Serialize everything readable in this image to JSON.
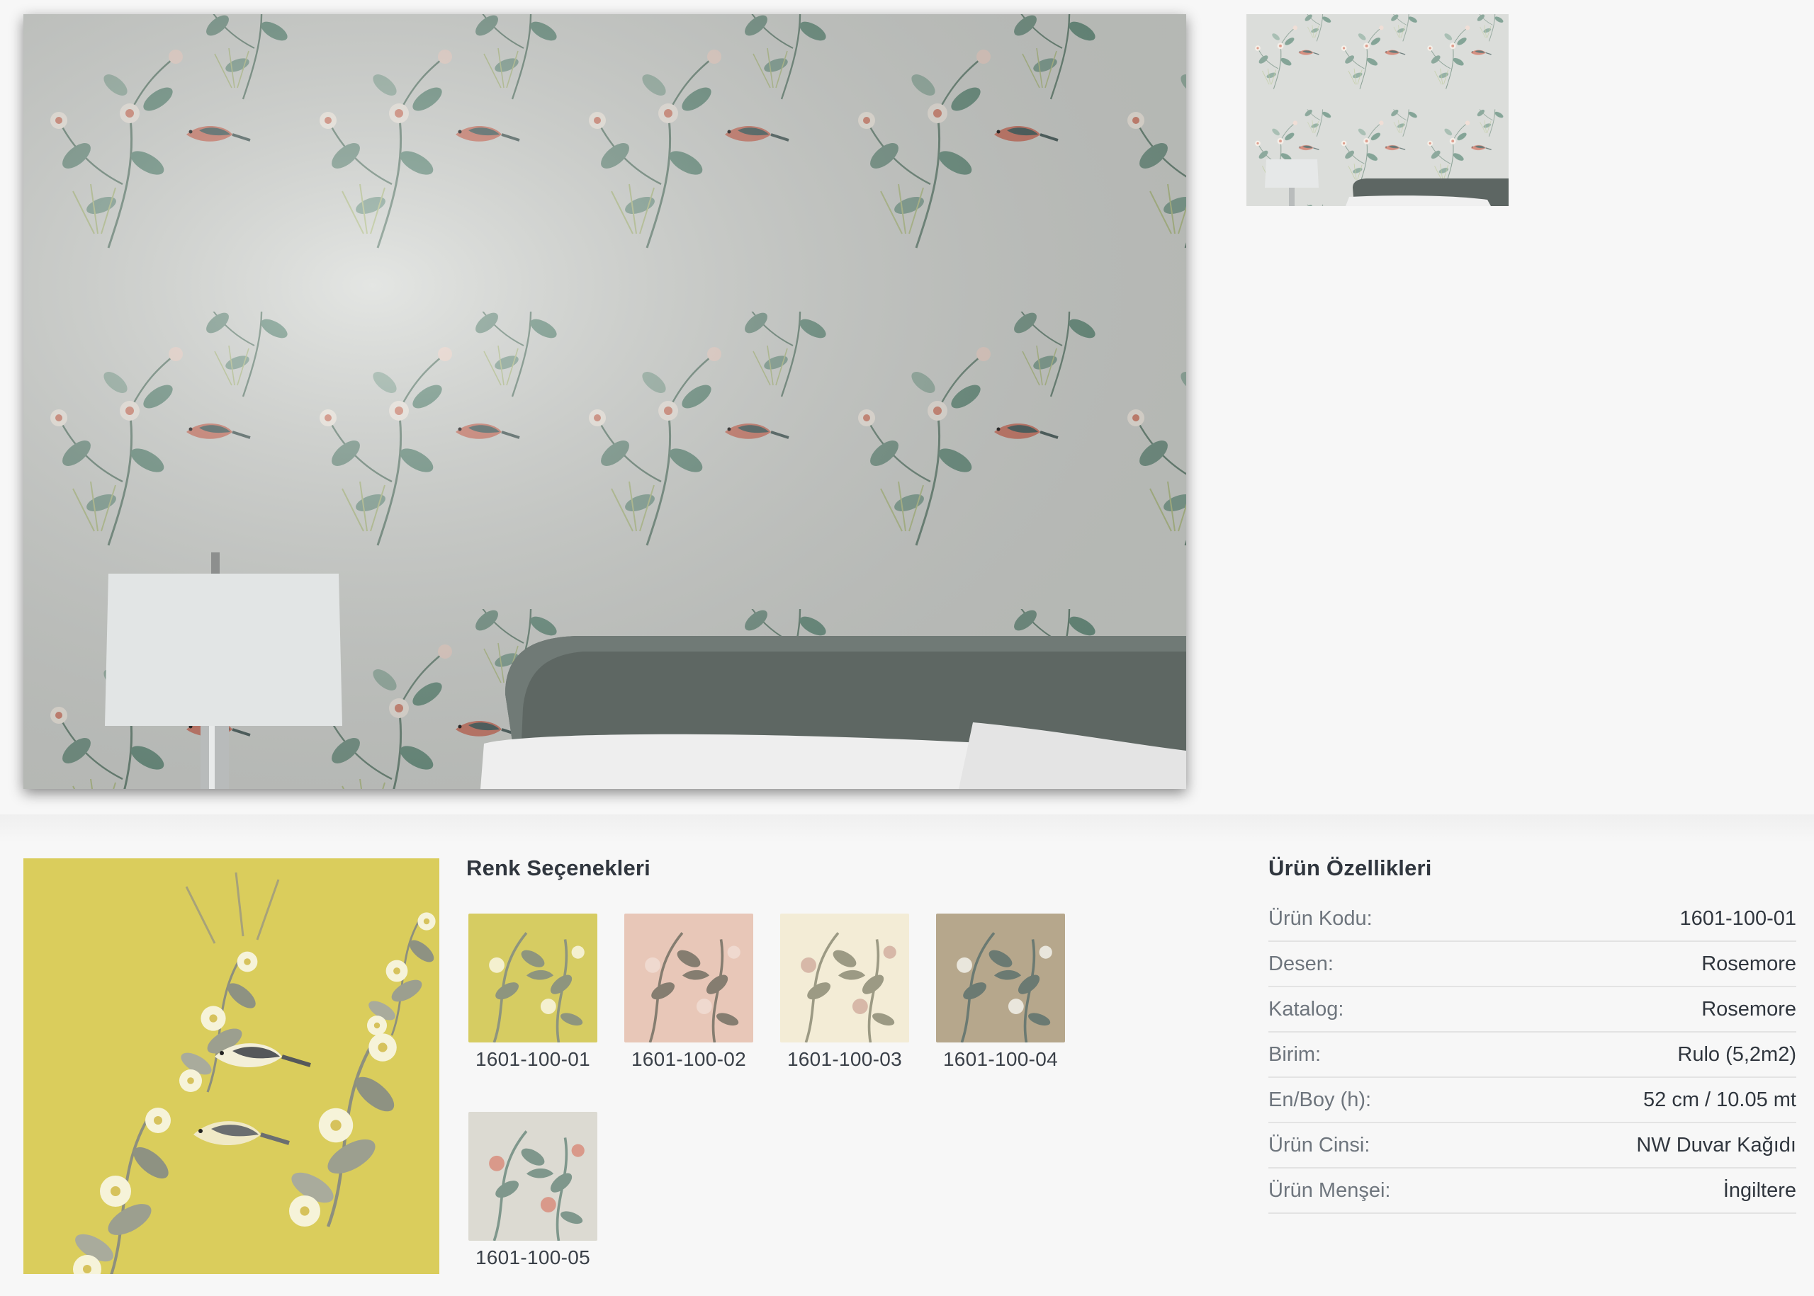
{
  "gallery": {
    "main_image_alt": "Rosemore wallpaper room scene",
    "thumb_image_alt": "Rosemore wallpaper thumbnail"
  },
  "colors": {
    "wall": "#d4d7d3",
    "leaf": "#6f9585",
    "bird": "#cf7d6c",
    "headboard": "#5e6763",
    "yellow_bg": "#dacd5c"
  },
  "color_options": {
    "title": "Renk Seçenekleri",
    "items": [
      {
        "code": "1601-100-01",
        "bg": "#d6cc62",
        "leaf": "#8e957e",
        "flower": "#f4f0cf"
      },
      {
        "code": "1601-100-02",
        "bg": "#e8c7b8",
        "leaf": "#857d70",
        "flower": "#efd9cf"
      },
      {
        "code": "1601-100-03",
        "bg": "#f3ecd6",
        "leaf": "#9c9a84",
        "flower": "#d7b8a8"
      },
      {
        "code": "1601-100-04",
        "bg": "#b6a78c",
        "leaf": "#6b7a72",
        "flower": "#e9e6dc"
      },
      {
        "code": "1601-100-05",
        "bg": "#dcdad2",
        "leaf": "#7f978c",
        "flower": "#d9998a"
      }
    ]
  },
  "specs": {
    "title": "Ürün Özellikleri",
    "rows": [
      {
        "key": "Ürün Kodu:",
        "value": "1601-100-01"
      },
      {
        "key": "Desen:",
        "value": "Rosemore"
      },
      {
        "key": "Katalog:",
        "value": "Rosemore"
      },
      {
        "key": "Birim:",
        "value": "Rulo (5,2m2)"
      },
      {
        "key": "En/Boy (h):",
        "value": "52 cm / 10.05 mt"
      },
      {
        "key": "Ürün Cinsi:",
        "value": "NW Duvar Kağıdı"
      },
      {
        "key": "Ürün Menşei:",
        "value": "İngiltere"
      }
    ]
  }
}
